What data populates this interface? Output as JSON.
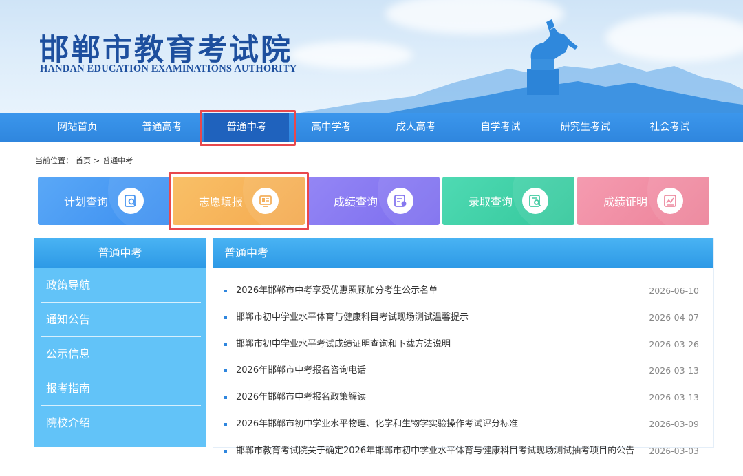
{
  "header": {
    "title": "邯郸市教育考试院",
    "subtitle": "HANDAN EDUCATION EXAMINATIONS AUTHORITY"
  },
  "nav": {
    "items": [
      {
        "label": "网站首页"
      },
      {
        "label": "普通高考"
      },
      {
        "label": "普通中考",
        "active": true
      },
      {
        "label": "高中学考"
      },
      {
        "label": "成人高考"
      },
      {
        "label": "自学考试"
      },
      {
        "label": "研究生考试"
      },
      {
        "label": "社会考试"
      }
    ]
  },
  "breadcrumb": {
    "prefix": "当前位置：",
    "home": "首页",
    "separator": ">",
    "current": "普通中考"
  },
  "cards": [
    {
      "label": "计划查询",
      "icon": "search-document-icon",
      "color": "#4c9cf2"
    },
    {
      "label": "志愿填报",
      "icon": "form-monitor-icon",
      "color": "#f6b35a"
    },
    {
      "label": "成绩查询",
      "icon": "score-card-icon",
      "color": "#8a7cf0"
    },
    {
      "label": "录取查询",
      "icon": "admission-search-icon",
      "color": "#3fd0a8"
    },
    {
      "label": "成绩证明",
      "icon": "certificate-icon",
      "color": "#ef8fa5"
    }
  ],
  "sidebar": {
    "title": "普通中考",
    "items": [
      {
        "label": "政策导航"
      },
      {
        "label": "通知公告"
      },
      {
        "label": "公示信息"
      },
      {
        "label": "报考指南"
      },
      {
        "label": "院校介绍"
      }
    ]
  },
  "panel": {
    "title": "普通中考",
    "news": [
      {
        "title": "2026年邯郸市中考享受优惠照顾加分考生公示名单",
        "date": "2026-06-10"
      },
      {
        "title": "邯郸市初中学业水平体育与健康科目考试现场测试温馨提示",
        "date": "2026-04-07"
      },
      {
        "title": "邯郸市初中学业水平考试成绩证明查询和下载方法说明",
        "date": "2026-03-26"
      },
      {
        "title": "2026年邯郸市中考报名咨询电话",
        "date": "2026-03-13"
      },
      {
        "title": "2026年邯郸市中考报名政策解读",
        "date": "2026-03-13"
      },
      {
        "title": "2026年邯郸市初中学业水平物理、化学和生物学实验操作考试评分标准",
        "date": "2026-03-09"
      },
      {
        "title": "邯郸市教育考试院关于确定2026年邯郸市初中学业水平体育与健康科目考试现场测试抽考项目的公告",
        "date": "2026-03-03"
      }
    ]
  },
  "colors": {
    "brand_blue": "#1d4f9e",
    "nav_blue": "#2f86de",
    "nav_active": "#1f62bd",
    "highlight_red": "#e8484d",
    "sidebar_blue": "#62c3f8"
  }
}
